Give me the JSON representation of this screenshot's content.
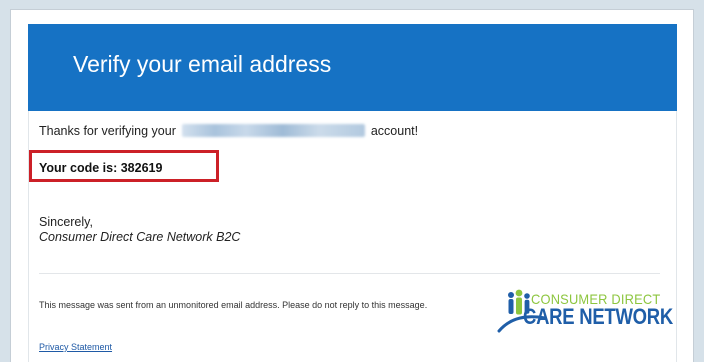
{
  "header": {
    "title": "Verify your email address"
  },
  "body": {
    "thanks_prefix": "Thanks for verifying your",
    "thanks_suffix": "account!",
    "code_label": "Your code is: 382619",
    "sign_off": "Sincerely,",
    "signature": "Consumer Direct Care Network B2C"
  },
  "footer": {
    "note": "This message was sent from an unmonitored email address. Please do not reply to this message.",
    "privacy_link": "Privacy Statement"
  },
  "logo": {
    "line1": "CONSUMER DIRECT",
    "line2": "CARE NETWORK"
  },
  "colors": {
    "header_blue": "#1672c4",
    "highlight_red": "#cc2027",
    "logo_green": "#8dc63f",
    "logo_blue": "#1f5ea8"
  }
}
